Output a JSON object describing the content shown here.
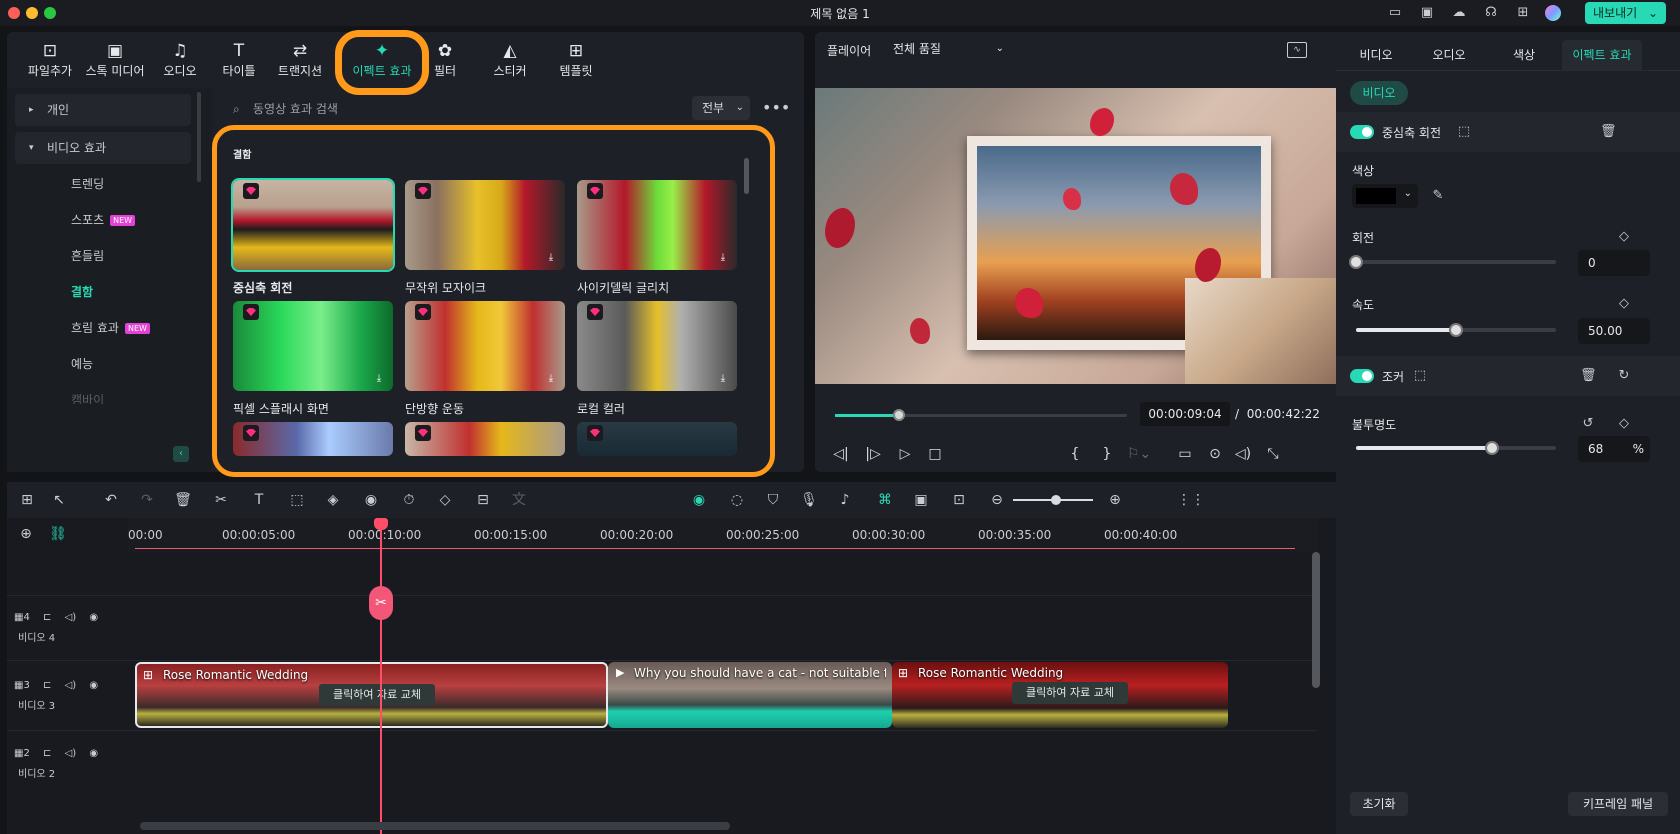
{
  "window": {
    "title": "제목 없음 1",
    "export_label": "내보내기"
  },
  "media_tabs": [
    {
      "label": "파일추가",
      "icon": "file-add-icon"
    },
    {
      "label": "스톡 미디어",
      "icon": "stock-media-icon"
    },
    {
      "label": "오디오",
      "icon": "music-note-icon"
    },
    {
      "label": "타이틀",
      "icon": "text-title-icon"
    },
    {
      "label": "트랜지션",
      "icon": "transition-icon"
    },
    {
      "label": "이펙트 효과",
      "icon": "effects-star-icon"
    },
    {
      "label": "필터",
      "icon": "filter-icon"
    },
    {
      "label": "스티커",
      "icon": "sticker-icon"
    },
    {
      "label": "템플릿",
      "icon": "template-icon"
    }
  ],
  "sidebar": {
    "personal": "개인",
    "video_effects": "비디오 효과",
    "items": [
      {
        "label": "트렌딩",
        "badge": ""
      },
      {
        "label": "스포츠",
        "badge": "NEW"
      },
      {
        "label": "흔들림",
        "badge": ""
      },
      {
        "label": "결함",
        "badge": ""
      },
      {
        "label": "흐림 효과",
        "badge": "NEW"
      },
      {
        "label": "예능",
        "badge": ""
      },
      {
        "label": "캠바이",
        "badge": ""
      }
    ]
  },
  "search": {
    "placeholder": "동영상 효과 검색",
    "filter": "전부"
  },
  "group_label": "결함",
  "effects": [
    {
      "label": "중심축 회전"
    },
    {
      "label": "무작위 모자이크"
    },
    {
      "label": "사이키델릭 글리치"
    },
    {
      "label": "픽셀 스플래시 화면"
    },
    {
      "label": "단방향 운동"
    },
    {
      "label": "로컬 컬러"
    }
  ],
  "player": {
    "label": "플레이어",
    "quality": "전체 품질",
    "current_time": "00:00:09:04",
    "separator": "/",
    "duration": "00:00:42:22",
    "progress": 0.22
  },
  "props": {
    "tabs": [
      "비디오",
      "오디오",
      "색상",
      "이펙트 효과"
    ],
    "chip": "비디오",
    "effect1_name": "중심축 회전",
    "color_label": "색상",
    "rotate_label": "회전",
    "rotate_value": "0",
    "rotate_level": 0,
    "speed_label": "속도",
    "speed_value": "50.00",
    "speed_level": 0.5,
    "effect2_name": "조커",
    "opacity_label": "불투명도",
    "opacity_value": "68",
    "opacity_unit": "%",
    "opacity_level": 0.68,
    "reset_label": "초기화",
    "keyframe_label": "키프레임 패널"
  },
  "timeline": {
    "ruler": [
      "00:00",
      "00:00:05:00",
      "00:00:10:00",
      "00:00:15:00",
      "00:00:20:00",
      "00:00:25:00",
      "00:00:30:00",
      "00:00:35:00",
      "00:00:40:00"
    ],
    "tracks": [
      {
        "num": "4",
        "label": "비디오 4"
      },
      {
        "num": "3",
        "label": "비디오 3"
      },
      {
        "num": "2",
        "label": "비디오 2"
      }
    ],
    "clips": [
      {
        "title": "Rose Romantic Wedding",
        "replace": "클릭하여 자료 교체"
      },
      {
        "title": "Why you should have a cat - not suitable for s..."
      },
      {
        "title": "Rose Romantic Wedding",
        "replace": "클릭하여 자료 교체"
      }
    ]
  },
  "colors": {
    "accent": "#27d9b4",
    "highlight": "#ff9a1a",
    "playhead": "#ff4d6a"
  }
}
